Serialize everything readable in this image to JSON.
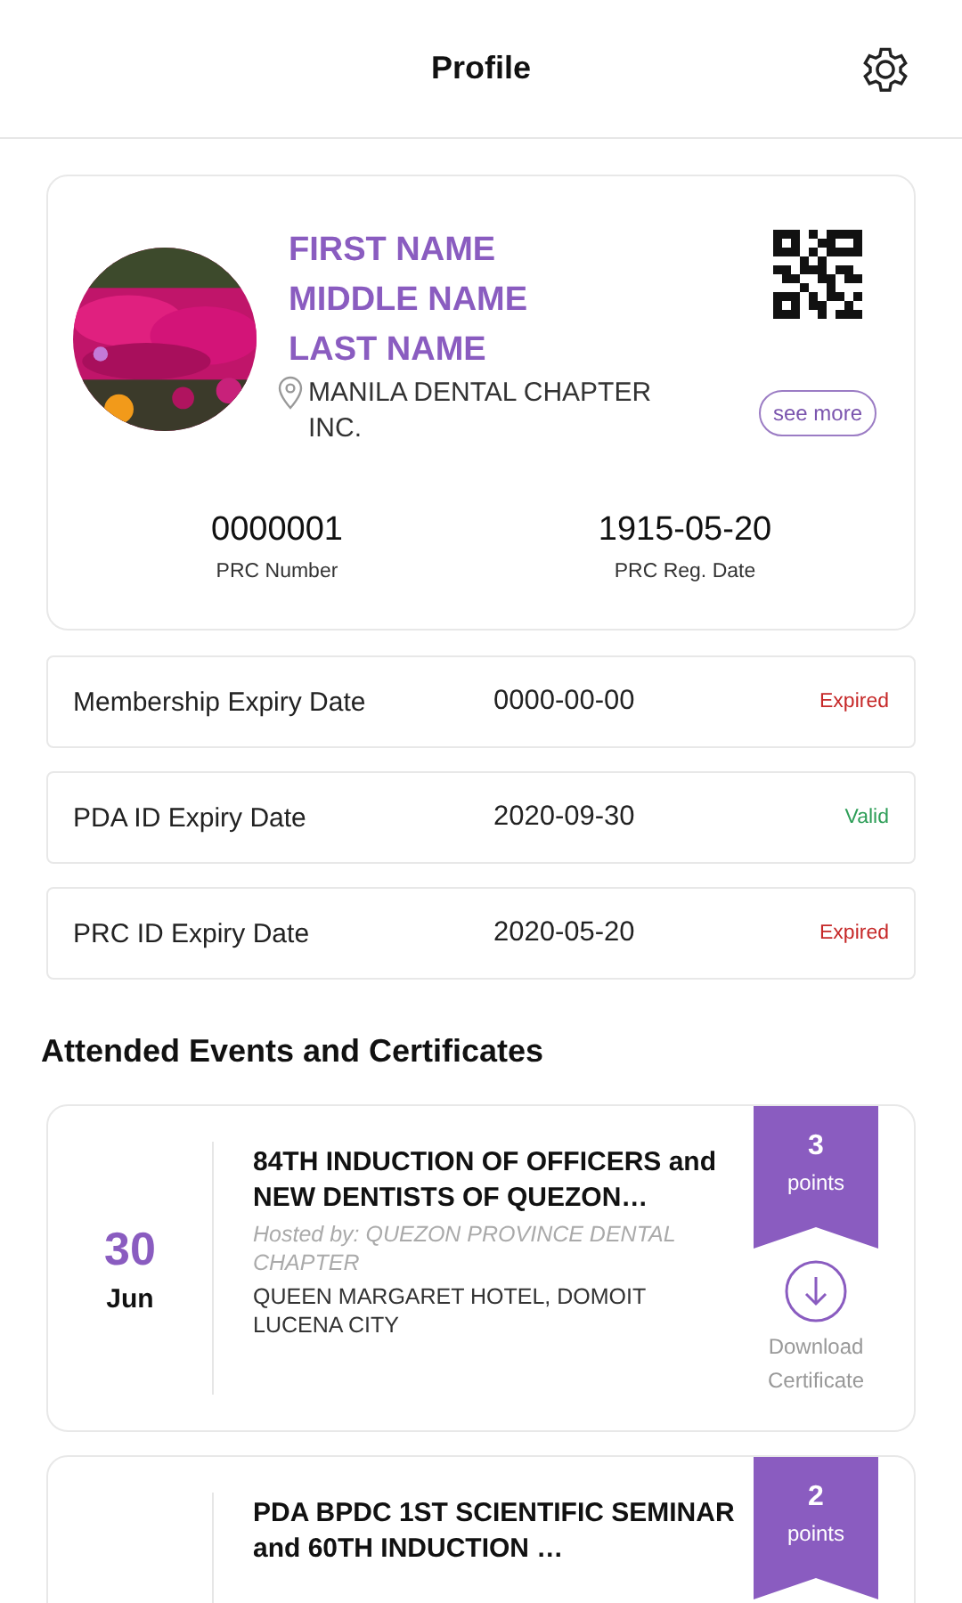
{
  "header": {
    "title": "Profile"
  },
  "profile": {
    "first_name": "FIRST NAME",
    "middle_name": "MIDDLE NAME",
    "last_name": "LAST NAME",
    "chapter": "MANILA DENTAL CHAPTER INC.",
    "see_more": "see more",
    "stats": [
      {
        "value": "0000001",
        "label": "PRC Number"
      },
      {
        "value": "1915-05-20",
        "label": "PRC Reg. Date"
      }
    ]
  },
  "expiry_rows": [
    {
      "label": "Membership Expiry Date",
      "date": "0000-00-00",
      "status": "Expired",
      "kind": "expired"
    },
    {
      "label": "PDA ID Expiry Date",
      "date": "2020-09-30",
      "status": "Valid",
      "kind": "valid"
    },
    {
      "label": "PRC ID Expiry Date",
      "date": "2020-05-20",
      "status": "Expired",
      "kind": "expired"
    }
  ],
  "events_heading": "Attended Events and Certificates",
  "events": [
    {
      "day": "30",
      "month": "Jun",
      "title": "84TH INDUCTION OF OFFICERS and NEW DENTISTS OF QUEZON…",
      "host": "Hosted by: QUEZON PROVINCE DENTAL CHAPTER",
      "venue": "QUEEN MARGARET HOTEL, DOMOIT LUCENA CITY",
      "points": "3",
      "points_label": "points",
      "download": "Download Certificate"
    },
    {
      "title": "PDA BPDC 1ST SCIENTIFIC SEMINAR and 60TH INDUCTION …",
      "points": "2",
      "points_label": "points"
    }
  ]
}
